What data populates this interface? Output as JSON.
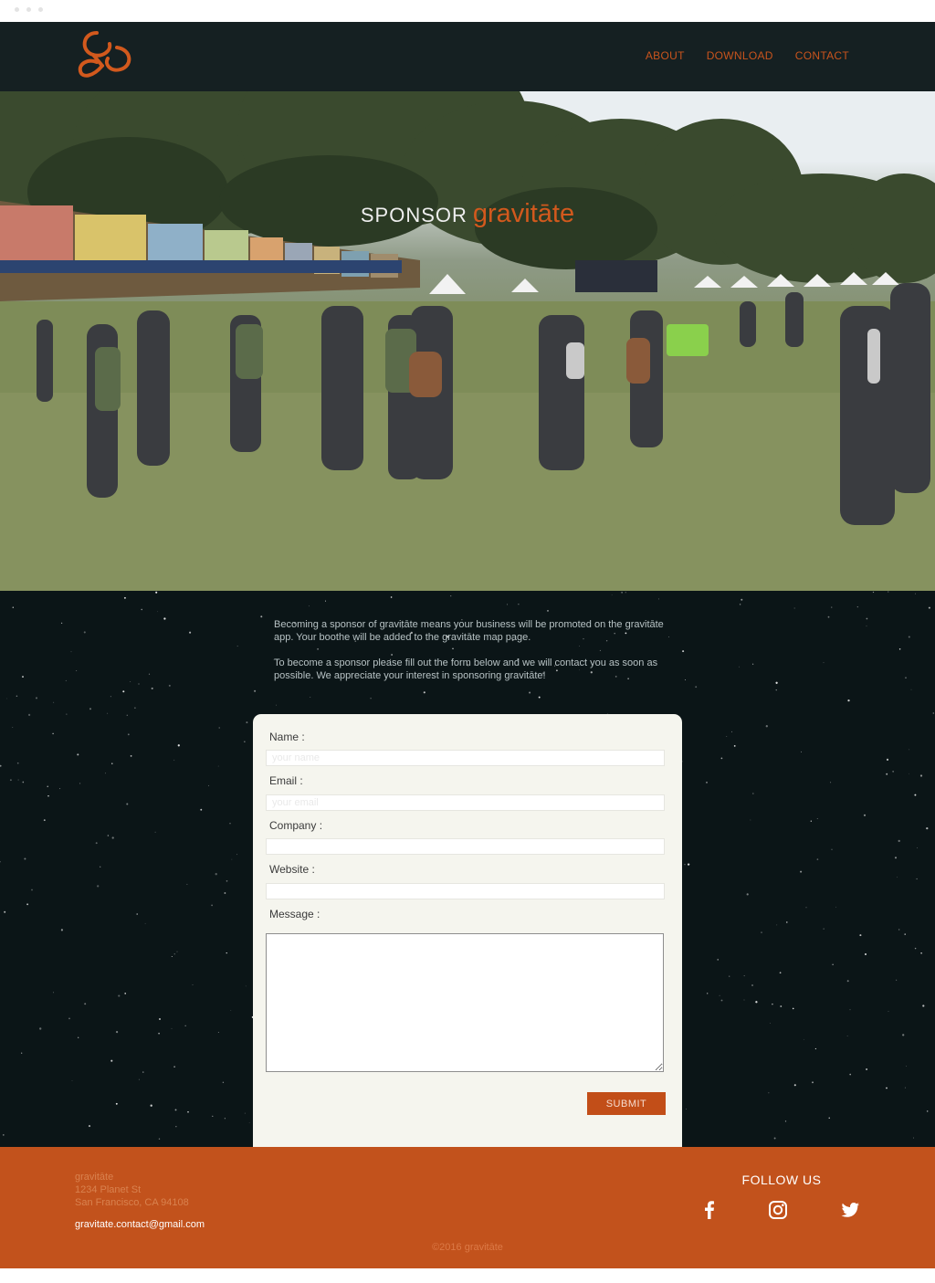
{
  "header": {
    "logo_name": "gravitate-logo",
    "nav": [
      "ABOUT",
      "DOWNLOAD",
      "CONTACT"
    ]
  },
  "hero": {
    "title_prefix": "SPONSOR",
    "title_brand": "gravitāte"
  },
  "intro": {
    "p1": "Becoming a sponsor of gravitāte means your business will be promoted on the gravitāte app. Your boothe will be added to the gravitāte map page.",
    "p2": "To become a sponsor please fill out the form below and we will contact you as soon as possible. We appreciate your interest in sponsoring gravitāte!"
  },
  "form": {
    "name_label": "Name :",
    "name_placeholder": "your name",
    "email_label": "Email :",
    "email_placeholder": "your email",
    "company_label": "Company :",
    "company_placeholder": "",
    "website_label": "Website :",
    "website_placeholder": "",
    "message_label": "Message :",
    "message_value": "",
    "submit_label": "SUBMIT"
  },
  "footer": {
    "brand": "gravitāte",
    "street": "1234 Planet St",
    "city": "San Francisco, CA 94108",
    "email": "gravitate.contact@gmail.com",
    "follow_label": "FOLLOW US",
    "copyright": "©2016 gravitāte",
    "social": [
      "facebook-icon",
      "instagram-icon",
      "twitter-icon"
    ]
  },
  "colors": {
    "accent": "#c2521c",
    "header_bg": "#152022",
    "section_bg": "#0b1517",
    "card_bg": "#f5f5ee"
  }
}
